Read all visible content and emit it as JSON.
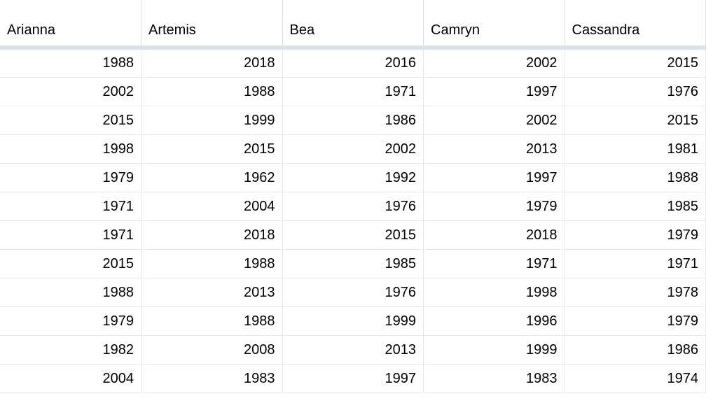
{
  "table": {
    "columns": [
      "Arianna",
      "Artemis",
      "Bea",
      "Camryn",
      "Cassandra"
    ],
    "rows": [
      [
        1988,
        2018,
        2016,
        2002,
        2015
      ],
      [
        2002,
        1988,
        1971,
        1997,
        1976
      ],
      [
        2015,
        1999,
        1986,
        2002,
        2015
      ],
      [
        1998,
        2015,
        2002,
        2013,
        1981
      ],
      [
        1979,
        1962,
        1992,
        1997,
        1988
      ],
      [
        1971,
        2004,
        1976,
        1979,
        1985
      ],
      [
        1971,
        2018,
        2015,
        2018,
        1979
      ],
      [
        2015,
        1988,
        1985,
        1971,
        1971
      ],
      [
        1988,
        2013,
        1976,
        1998,
        1978
      ],
      [
        1979,
        1988,
        1999,
        1996,
        1979
      ],
      [
        1982,
        2008,
        2013,
        1999,
        1986
      ],
      [
        2004,
        1983,
        1997,
        1983,
        1974
      ]
    ]
  }
}
